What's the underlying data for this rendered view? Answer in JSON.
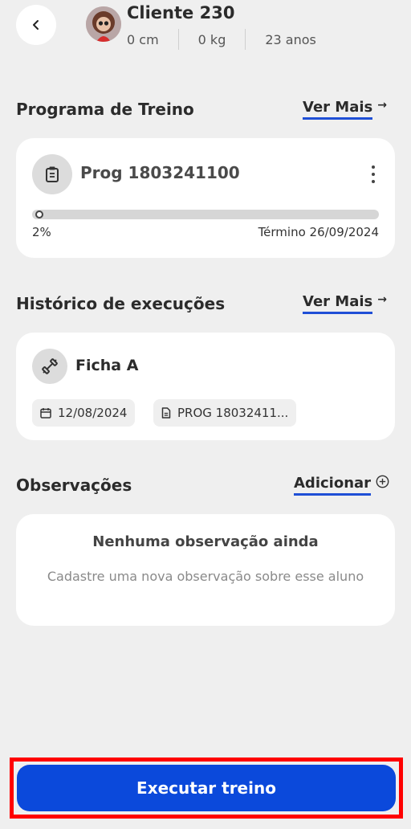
{
  "header": {
    "back_icon": "chevron-left-icon",
    "client_name": "Cliente 230",
    "height": "0 cm",
    "weight": "0 kg",
    "age": "23 anos"
  },
  "program": {
    "section_title": "Programa de Treino",
    "see_more": "Ver Mais",
    "name": "Prog 1803241100",
    "progress_text": "2%",
    "progress_value": 0.02,
    "end_date": "Término 26/09/2024",
    "icon": "clipboard-icon",
    "menu_icon": "kebab-menu-icon"
  },
  "history": {
    "section_title": "Histórico de execuções",
    "see_more": "Ver Mais",
    "item_name": "Ficha A",
    "date": "12/08/2024",
    "program_ref": "PROG 18032411...",
    "icon": "dumbbell-icon"
  },
  "observations": {
    "section_title": "Observações",
    "add_label": "Adicionar",
    "empty_title": "Nenhuma observação ainda",
    "empty_subtitle": "Cadastre uma nova observação sobre esse aluno"
  },
  "cta": {
    "label": "Executar treino"
  },
  "colors": {
    "accent": "#1f4fd6",
    "cta": "#0b49db",
    "highlight": "#ff0000"
  }
}
